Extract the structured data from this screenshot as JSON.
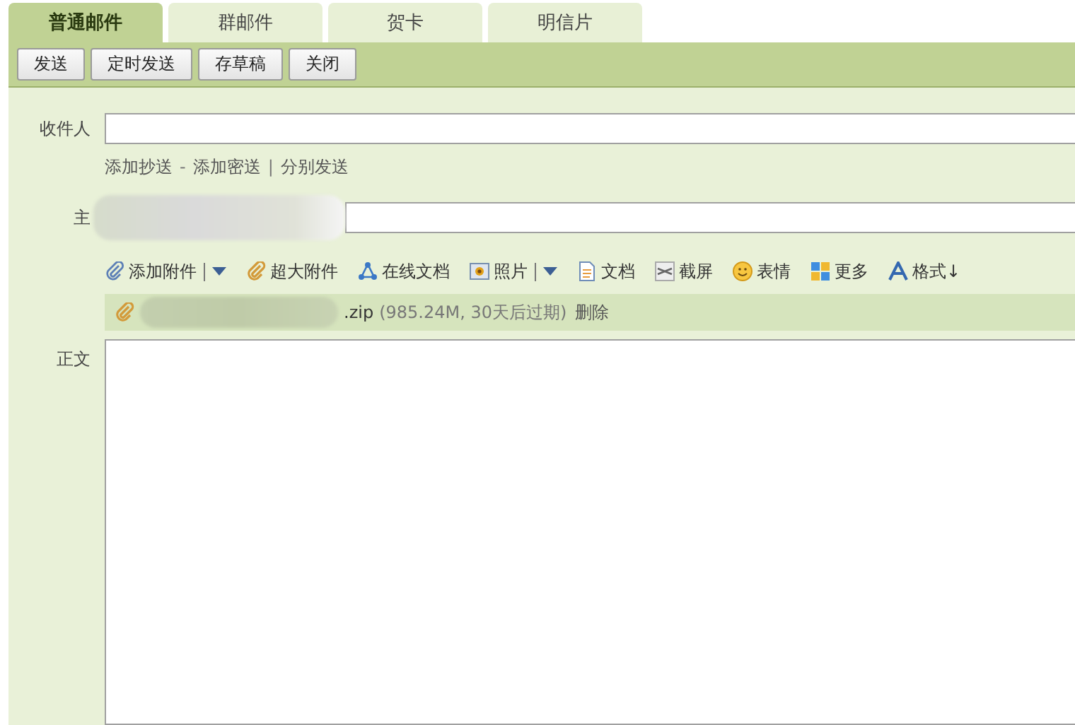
{
  "tabs": [
    {
      "label": "普通邮件",
      "selected": true
    },
    {
      "label": "群邮件",
      "selected": false
    },
    {
      "label": "贺卡",
      "selected": false
    },
    {
      "label": "明信片",
      "selected": false
    }
  ],
  "actions": [
    "发送",
    "定时发送",
    "存草稿",
    "关闭"
  ],
  "recipient": {
    "label": "收件人"
  },
  "cc_links": [
    {
      "text": "添加抄送",
      "kind": "link"
    },
    {
      "text": "-",
      "kind": "separator"
    },
    {
      "text": "添加密送",
      "kind": "link"
    },
    {
      "text": "|",
      "kind": "separator"
    },
    {
      "text": "分别发送",
      "kind": "link"
    }
  ],
  "subject": {
    "label": "主"
  },
  "attach_toolbar": [
    {
      "label": "添加附件",
      "dropdown": true
    },
    {
      "label": "超大附件",
      "dropdown": false
    },
    {
      "label": "在线文档",
      "dropdown": false
    },
    {
      "label": "照片",
      "dropdown": true
    },
    {
      "label": "文档",
      "dropdown": false
    },
    {
      "label": "截屏",
      "dropdown": false
    },
    {
      "label": "表情",
      "dropdown": false
    },
    {
      "label": "更多",
      "dropdown": false
    },
    {
      "label": "格式↓",
      "dropdown": false
    }
  ],
  "attachment": {
    "name": ".zip",
    "info": "(985.24M, 30天后过期)",
    "action": "删除"
  },
  "body": {
    "label": "正文"
  }
}
